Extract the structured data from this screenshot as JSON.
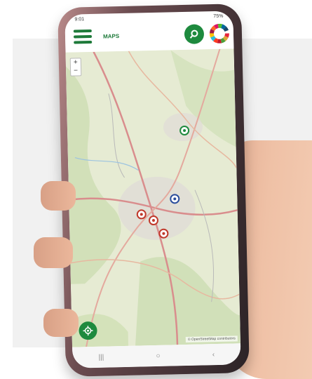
{
  "status_bar": {
    "time": "9:01",
    "battery": "75%"
  },
  "header": {
    "title": "MAPS"
  },
  "map": {
    "zoom_in": "+",
    "zoom_out": "−",
    "attribution": "© OpenStreetMap contributors",
    "markers": [
      {
        "color": "green",
        "name": "marker-green-north"
      },
      {
        "color": "blue",
        "name": "marker-blue-center"
      },
      {
        "color": "red",
        "name": "marker-red-1"
      },
      {
        "color": "red",
        "name": "marker-red-2"
      },
      {
        "color": "red",
        "name": "marker-red-3"
      }
    ]
  },
  "navbar": {
    "recent": "|||",
    "home": "○",
    "back": "‹"
  },
  "colors": {
    "brand": "#1e8a3e",
    "marker_red": "#c0392b",
    "marker_blue": "#2a4d9c"
  },
  "icons": [
    "menu-icon",
    "search-icon",
    "sdg-wheel-icon",
    "locate-icon"
  ]
}
